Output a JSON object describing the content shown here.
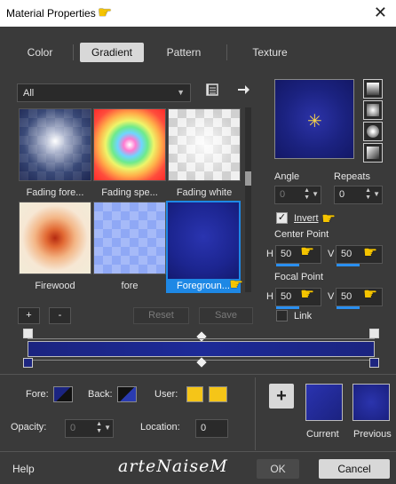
{
  "window": {
    "title": "Material Properties",
    "close_glyph": "✕"
  },
  "tabs": [
    {
      "label": "Color",
      "active": false
    },
    {
      "label": "Gradient",
      "active": true
    },
    {
      "label": "Pattern",
      "active": false
    },
    {
      "label": "Texture",
      "active": false
    }
  ],
  "category_dropdown": {
    "value": "All"
  },
  "icons": {
    "library": "book-icon",
    "go_to": "arrow-right-icon"
  },
  "gradients": [
    {
      "label": "Fading fore..."
    },
    {
      "label": "Fading spe..."
    },
    {
      "label": "Fading white"
    },
    {
      "label": "Firewood"
    },
    {
      "label": "fore"
    },
    {
      "label": "Foregroun...",
      "selected": true
    }
  ],
  "list_buttons": {
    "add": "+",
    "remove": "-",
    "reset": "Reset",
    "save": "Save"
  },
  "angle": {
    "label": "Angle",
    "value": "0"
  },
  "repeats": {
    "label": "Repeats",
    "value": "0"
  },
  "invert": {
    "label": "Invert",
    "checked": true
  },
  "center_point": {
    "label": "Center Point",
    "h_label": "H",
    "h_value": "50",
    "v_label": "V",
    "v_value": "50"
  },
  "focal_point": {
    "label": "Focal Point",
    "h_label": "H",
    "h_value": "50",
    "v_label": "V",
    "v_value": "50"
  },
  "link": {
    "label": "Link",
    "checked": false
  },
  "footer_fields": {
    "fore_label": "Fore:",
    "back_label": "Back:",
    "user_label": "User:",
    "opacity_label": "Opacity:",
    "opacity_value": "0",
    "location_label": "Location:",
    "location_value": "0"
  },
  "swatches": {
    "current_label": "Current",
    "previous_label": "Previous",
    "add": "+"
  },
  "colors": {
    "accent": "#1e88e5",
    "gradient_blue": "#1b2480",
    "user_yellow": "#f5c518"
  },
  "bottom": {
    "help": "Help",
    "brand": "arteNaiseM",
    "ok": "OK",
    "cancel": "Cancel"
  }
}
